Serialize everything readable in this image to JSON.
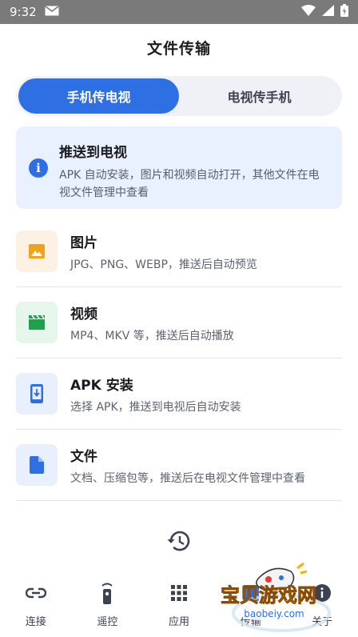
{
  "status_bar": {
    "time": "9:32"
  },
  "header": {
    "title": "文件传输"
  },
  "tabs": [
    {
      "label": "手机传电视",
      "active": true
    },
    {
      "label": "电视传手机",
      "active": false
    }
  ],
  "info_card": {
    "title": "推送到电视",
    "description": "APK 自动安装，图片和视频自动打开，其他文件在电视文件管理中查看"
  },
  "file_types": [
    {
      "title": "图片",
      "description": "JPG、PNG、WEBP，推送后自动预览",
      "icon": "image-icon",
      "icon_bg": "#fdf1e4",
      "icon_color": "#f0a21b"
    },
    {
      "title": "视频",
      "description": "MP4、MKV 等，推送后自动播放",
      "icon": "video-icon",
      "icon_bg": "#e6f6ea",
      "icon_color": "#1aa34a"
    },
    {
      "title": "APK 安装",
      "description": "选择 APK，推送到电视后自动安装",
      "icon": "apk-install-icon",
      "icon_bg": "#e8effd",
      "icon_color": "#2f6fe4"
    },
    {
      "title": "文件",
      "description": "文档、压缩包等，推送后在电视文件管理中查看",
      "icon": "file-icon",
      "icon_bg": "#e8effd",
      "icon_color": "#2f6fe4"
    }
  ],
  "bottom_nav": [
    {
      "label": "连接",
      "icon": "link-icon"
    },
    {
      "label": "遥控",
      "icon": "remote-icon"
    },
    {
      "label": "应用",
      "icon": "apps-grid-icon"
    },
    {
      "label": "传输",
      "icon": "transfer-icon"
    },
    {
      "label": "关于",
      "icon": "info-icon"
    }
  ],
  "watermark": {
    "text": "宝贝游戏网",
    "url": "baobeiy.com"
  },
  "colors": {
    "accent": "#2f6fe4",
    "info_bg": "#eaf1fe",
    "status_bar": "#7a7a7a"
  }
}
